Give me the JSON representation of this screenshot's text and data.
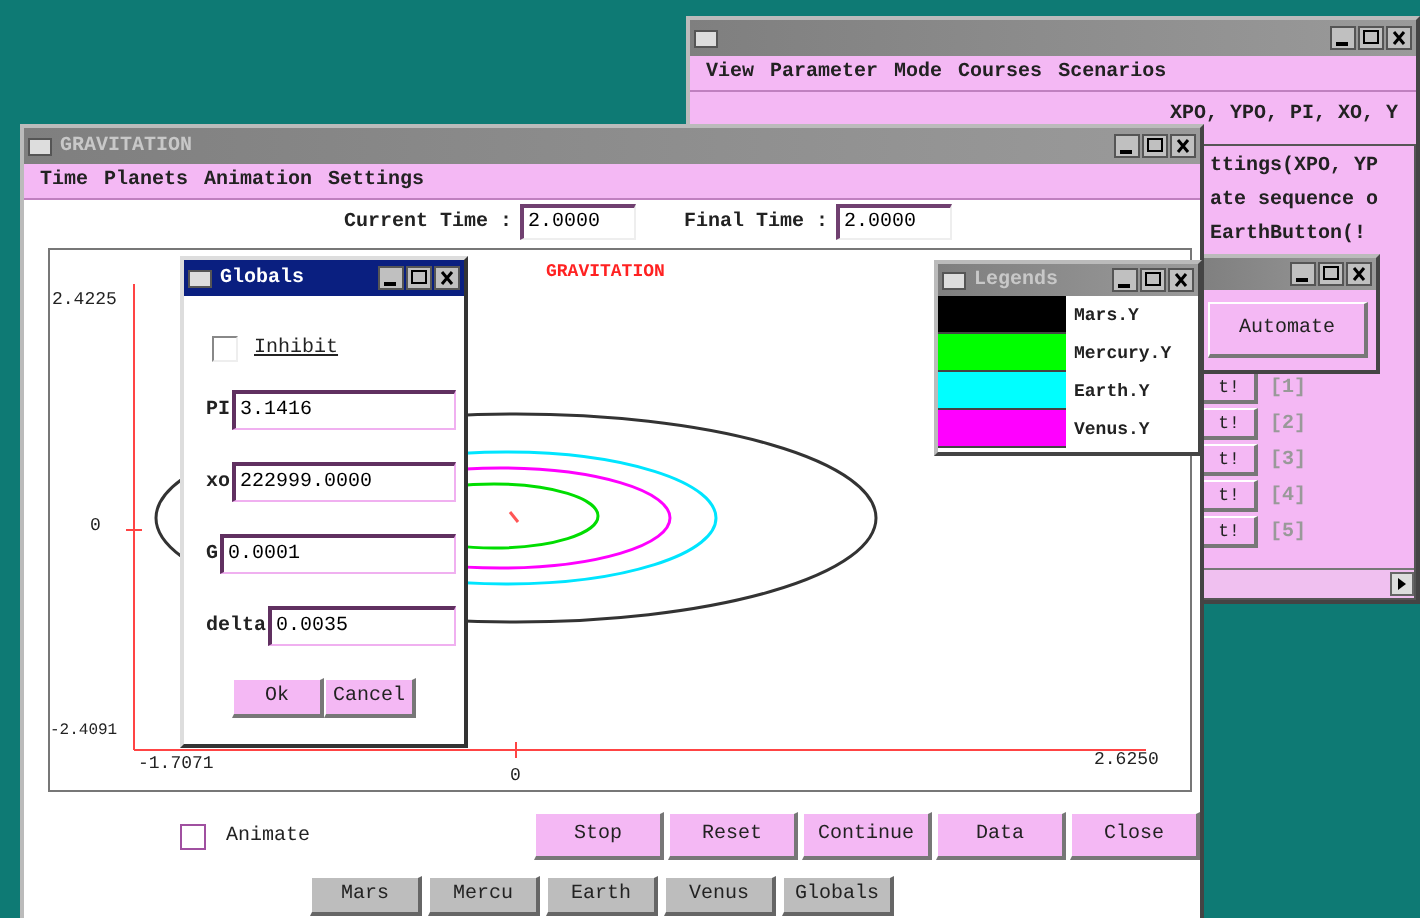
{
  "back_window": {
    "menu": [
      "View",
      "Parameter",
      "Mode",
      "Courses",
      "Scenarios"
    ],
    "lines": [
      "XPO, YPO, PI, XO, Y",
      "ttings(XPO, YP",
      "ate sequence o",
      "EarthButton(!"
    ],
    "list": [
      {
        "button": "t!",
        "label": "[1]"
      },
      {
        "button": "t!",
        "label": "[2]"
      },
      {
        "button": "t!",
        "label": "[3]"
      },
      {
        "button": "t!",
        "label": "[4]"
      },
      {
        "button": "t!",
        "label": "[5]"
      }
    ]
  },
  "step_window": {
    "button": "Automate"
  },
  "gravitation": {
    "title": "GRAVITATION",
    "menu": [
      "Time",
      "Planets",
      "Animation",
      "Settings"
    ],
    "current_time": {
      "label": "Current Time :",
      "value": "2.0000"
    },
    "final_time": {
      "label": "Final Time :",
      "value": "2.0000"
    },
    "chart_title": "GRAVITATION",
    "y_max": "2.4225",
    "y_mid": "0",
    "y_min": "-2.4091",
    "x_min": "-1.7071",
    "x_mid": "0",
    "x_max": "2.6250",
    "animate": {
      "label": "Animate",
      "checked": false
    },
    "buttons": [
      "Stop",
      "Reset",
      "Continue",
      "Data",
      "Close"
    ],
    "planet_buttons": [
      "Mars",
      "Mercu",
      "Earth",
      "Venus",
      "Globals"
    ]
  },
  "globals": {
    "title": "Globals",
    "inhibit": {
      "label": "Inhibit",
      "checked": false
    },
    "fields": [
      {
        "label": "PI",
        "value": "3.1416"
      },
      {
        "label": "xo",
        "value": "222999.0000"
      },
      {
        "label": "G",
        "value": "0.0001"
      },
      {
        "label": "delta",
        "value": "0.0035"
      }
    ],
    "buttons": [
      "Ok",
      "Cancel"
    ]
  },
  "legend": {
    "title": "Legends",
    "items": [
      {
        "label": "Mars.Y",
        "color": "#000000"
      },
      {
        "label": "Mercury.Y",
        "color": "#00ff00"
      },
      {
        "label": "Earth.Y",
        "color": "#00ffff"
      },
      {
        "label": "Venus.Y",
        "color": "#ff00ff"
      }
    ]
  }
}
